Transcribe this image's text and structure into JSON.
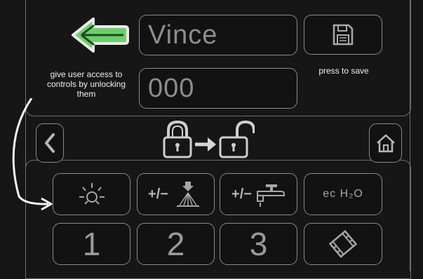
{
  "colors": {
    "background": "#161616",
    "back_arrow_fill": "#6ccf6b",
    "border": "#8a8a8a"
  },
  "profile": {
    "name_value": "Vince",
    "code_value": "000"
  },
  "labels": {
    "save_hint": "press to save",
    "unlock_hint": "give user access to controls by unlocking them"
  },
  "controls": {
    "row1": [
      {
        "name": "light-control",
        "label": ""
      },
      {
        "name": "water-spray-control",
        "label": "+/−"
      },
      {
        "name": "faucet-control",
        "label": "+/−"
      },
      {
        "name": "ec-h2o-control",
        "label": "ec H₂O"
      }
    ],
    "row2": [
      {
        "name": "preset-1",
        "label": "1"
      },
      {
        "name": "preset-2",
        "label": "2"
      },
      {
        "name": "preset-3",
        "label": "3"
      },
      {
        "name": "film-control",
        "label": ""
      }
    ]
  },
  "icons": [
    "arrow-left-icon",
    "floppy-disk-icon",
    "chevron-left-icon",
    "home-icon",
    "lock-to-unlock-icon",
    "curved-arrow-icon",
    "light-icon",
    "spray-icon",
    "faucet-icon",
    "film-icon"
  ]
}
